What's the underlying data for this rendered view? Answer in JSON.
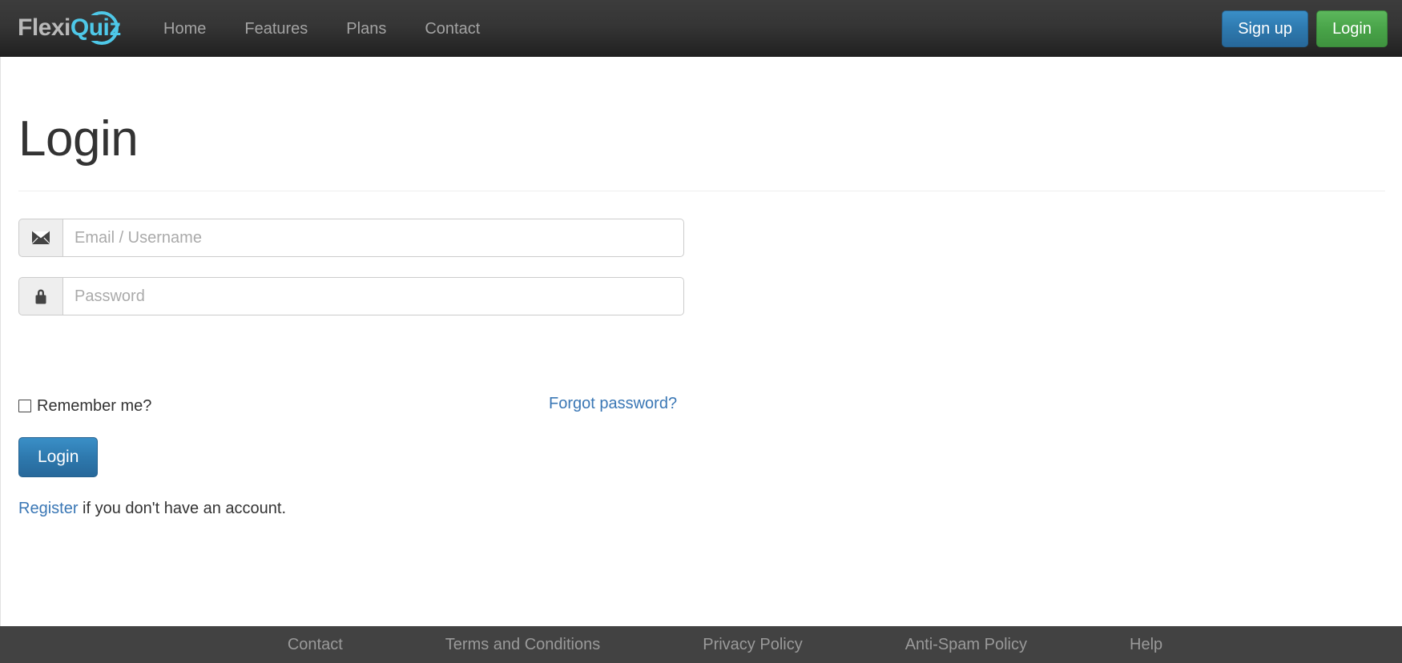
{
  "navbar": {
    "brand": {
      "text_primary": "Flexi",
      "text_accent": "Quiz",
      "accent_color": "#4ec8e8",
      "primary_color": "#b9b9b9"
    },
    "links": [
      {
        "label": "Home"
      },
      {
        "label": "Features"
      },
      {
        "label": "Plans"
      },
      {
        "label": "Contact"
      }
    ],
    "actions": {
      "signup_label": "Sign up",
      "login_label": "Login",
      "signup_color": "#2e79ae",
      "login_color": "#48a348"
    }
  },
  "main": {
    "title": "Login",
    "fields": [
      {
        "name": "email",
        "icon": "envelope-icon",
        "placeholder": "Email / Username",
        "value": ""
      },
      {
        "name": "password",
        "icon": "lock-icon",
        "placeholder": "Password",
        "value": ""
      }
    ],
    "remember": {
      "label": "Remember me?",
      "checked": false
    },
    "forgot_password_label": "Forgot password?",
    "submit_label": "Login",
    "register": {
      "link_label": "Register",
      "suffix_text": " if you don't have an account."
    },
    "link_color": "#3a77b5"
  },
  "footer": {
    "links": [
      {
        "label": "Contact"
      },
      {
        "label": "Terms and Conditions"
      },
      {
        "label": "Privacy Policy"
      },
      {
        "label": "Anti-Spam Policy"
      },
      {
        "label": "Help"
      }
    ],
    "background": "#424242",
    "text_color": "#9a9a9a"
  }
}
